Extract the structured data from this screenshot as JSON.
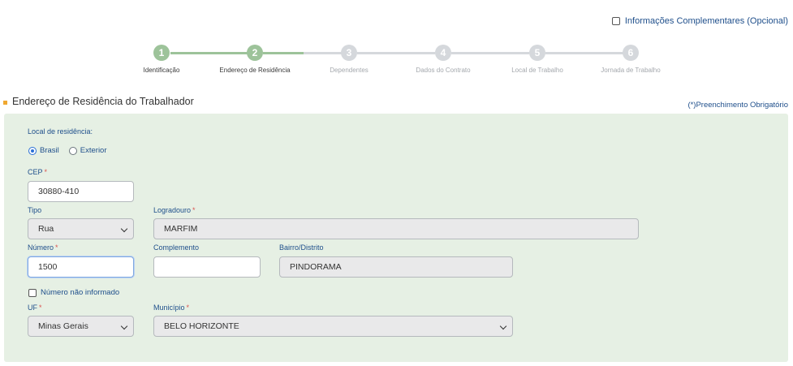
{
  "optional_info": {
    "label": "Informações Complementares (Opcional)"
  },
  "stepper": [
    {
      "num": "1",
      "label": "Identificação",
      "done": true
    },
    {
      "num": "2",
      "label": "Endereço de Residência",
      "done": true
    },
    {
      "num": "3",
      "label": "Dependentes",
      "done": false
    },
    {
      "num": "4",
      "label": "Dados do Contrato",
      "done": false
    },
    {
      "num": "5",
      "label": "Local de Trabalho",
      "done": false
    },
    {
      "num": "6",
      "label": "Jornada de Trabalho",
      "done": false
    }
  ],
  "section": {
    "title": "Endereço de Residência do Trabalhador",
    "required_note": "(*)Preenchimento Obrigatório"
  },
  "form": {
    "residence_label": "Local de residência:",
    "radio_brasil": "Brasil",
    "radio_exterior": "Exterior",
    "residence_selected": "Brasil",
    "cep_label": "CEP",
    "cep_value": "30880-410",
    "tipo_label": "Tipo",
    "tipo_value": "Rua",
    "logradouro_label": "Logradouro",
    "logradouro_value": "MARFIM",
    "numero_label": "Número",
    "numero_value": "1500",
    "complemento_label": "Complemento",
    "complemento_value": "",
    "bairro_label": "Bairro/Distrito",
    "bairro_value": "PINDORAMA",
    "numero_nao_informado": "Número não informado",
    "uf_label": "UF",
    "uf_value": "Minas Gerais",
    "municipio_label": "Município",
    "municipio_value": "BELO HORIZONTE",
    "required_mark": "*"
  },
  "colors": {
    "step_done": "#9dc39a",
    "step_todo": "#d5d8dc",
    "panel_bg": "#e6f0e4",
    "label_blue": "#1f4f8b",
    "required_red": "#d9534f",
    "section_bullet": "#f0a830"
  }
}
